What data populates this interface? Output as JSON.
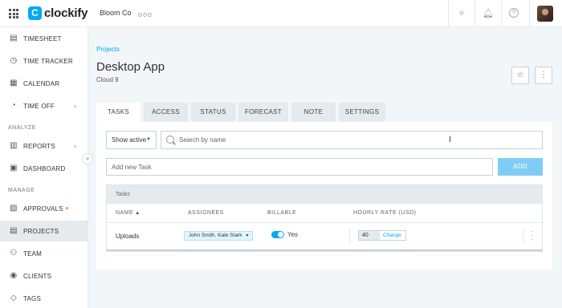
{
  "topbar": {
    "logo_text": "clockify",
    "logo_glyph": "C",
    "workspace": "Bloom Co",
    "more_glyph": "ooo",
    "icons": [
      "puzzle-icon",
      "bell-icon",
      "help-icon"
    ]
  },
  "sidebar": {
    "items": [
      {
        "label": "TIMESHEET",
        "icon": "timesheet-icon"
      },
      {
        "label": "TIME TRACKER",
        "icon": "clock-icon"
      },
      {
        "label": "CALENDAR",
        "icon": "calendar-icon"
      },
      {
        "label": "TIME OFF",
        "icon": "time-off-icon"
      },
      {
        "label": "REPORTS",
        "icon": "reports-icon"
      },
      {
        "label": "DASHBOARD",
        "icon": "dashboard-icon"
      },
      {
        "label": "APPROVALS",
        "icon": "approvals-icon"
      },
      {
        "label": "PROJECTS",
        "icon": "projects-icon"
      },
      {
        "label": "TEAM",
        "icon": "team-icon"
      },
      {
        "label": "CLIENTS",
        "icon": "clients-icon"
      },
      {
        "label": "TAGS",
        "icon": "tags-icon"
      }
    ],
    "sections": {
      "analyze": "ANALYZE",
      "manage": "MANAGE"
    },
    "active": "PROJECTS",
    "accent_dot_color": "#f49c1b"
  },
  "breadcrumb": "Projects",
  "project": {
    "title": "Desktop App",
    "client": "Cloud 9"
  },
  "tabs": [
    "TASKS",
    "ACCESS",
    "STATUS",
    "FORECAST",
    "NOTE",
    "SETTINGS"
  ],
  "active_tab": "TASKS",
  "filter": {
    "selected": "Show active"
  },
  "search": {
    "placeholder": "Search by name",
    "value": ""
  },
  "add_task": {
    "placeholder": "Add new Task",
    "button": "ADD"
  },
  "table": {
    "caption": "Tasks",
    "columns": [
      "NAME",
      "ASSIGNEES",
      "BILLABLE",
      "HOURLY RATE (USD)"
    ],
    "rows": [
      {
        "name": "Uploads",
        "assignees": "John Smith, Kate Stark",
        "billable": true,
        "billable_label": "Yes",
        "rate": "40",
        "rate_action": "Change"
      }
    ]
  },
  "colors": {
    "accent": "#03a9f4",
    "add_button": "#81ccf5",
    "background": "#f2f6f8"
  }
}
